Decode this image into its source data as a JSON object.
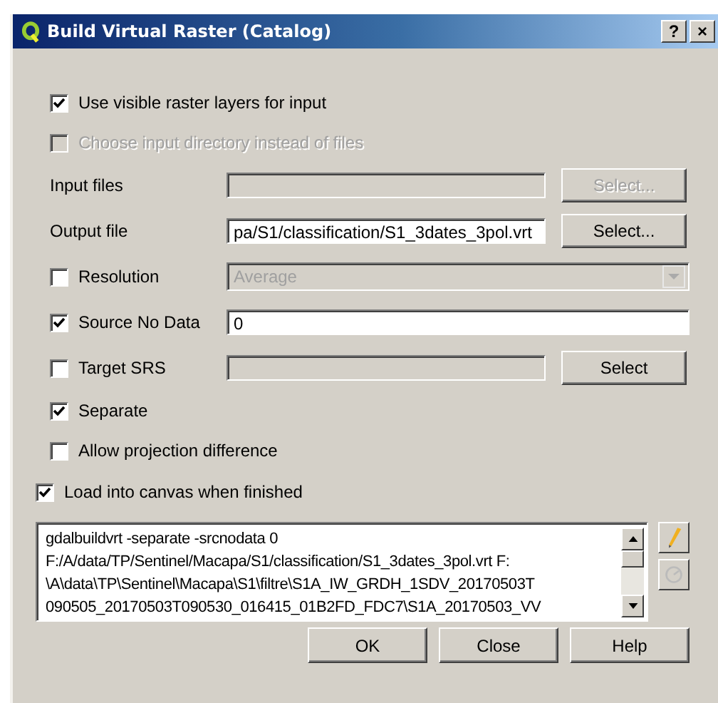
{
  "window": {
    "title": "Build Virtual Raster (Catalog)",
    "help_button": "?",
    "close_button": "×"
  },
  "options": [
    {
      "kind": "checkbox",
      "label": "Use visible raster layers for input",
      "checked": true,
      "disabled": false
    },
    {
      "kind": "checkbox",
      "label": "Choose input directory instead of files",
      "checked": false,
      "disabled": true
    },
    {
      "kind": "file",
      "label": "Input files",
      "disabled": true,
      "button": {
        "label": "Select...",
        "disabled": true
      }
    },
    {
      "kind": "file",
      "label": "Output file",
      "value": "pa/S1/classification/S1_3dates_3pol.vrt",
      "disabled": false,
      "button": {
        "label": "Select...",
        "disabled": false
      }
    },
    {
      "kind": "checked_combo",
      "label": "Resolution",
      "checked": false,
      "value": "Average",
      "disabled": true
    },
    {
      "kind": "checked_field",
      "label": "Source No Data",
      "checked": true,
      "value": "0",
      "disabled": false
    },
    {
      "kind": "checked_file",
      "label": "Target SRS",
      "checked": false,
      "disabled": true,
      "button": {
        "label": "Select",
        "disabled": false
      }
    },
    {
      "kind": "checkbox",
      "label": "Separate",
      "checked": true,
      "disabled": false
    },
    {
      "kind": "checkbox",
      "label": "Allow projection difference",
      "checked": false,
      "disabled": false
    }
  ],
  "load_into_canvas": {
    "label": "Load into canvas when finished",
    "checked": true
  },
  "command": {
    "lines": [
      "gdalbuildvrt -separate -srcnodata 0",
      "F:/A/data/TP/Sentinel/Macapa/S1/classification/S1_3dates_3pol.vrt F:",
      "\\A\\data\\TP\\Sentinel\\Macapa\\S1\\filtre\\S1A_IW_GRDH_1SDV_20170503T",
      "090505_20170503T090530_016415_01B2FD_FDC7\\S1A_20170503_VV"
    ]
  },
  "buttons": [
    "OK",
    "Close",
    "Help"
  ]
}
